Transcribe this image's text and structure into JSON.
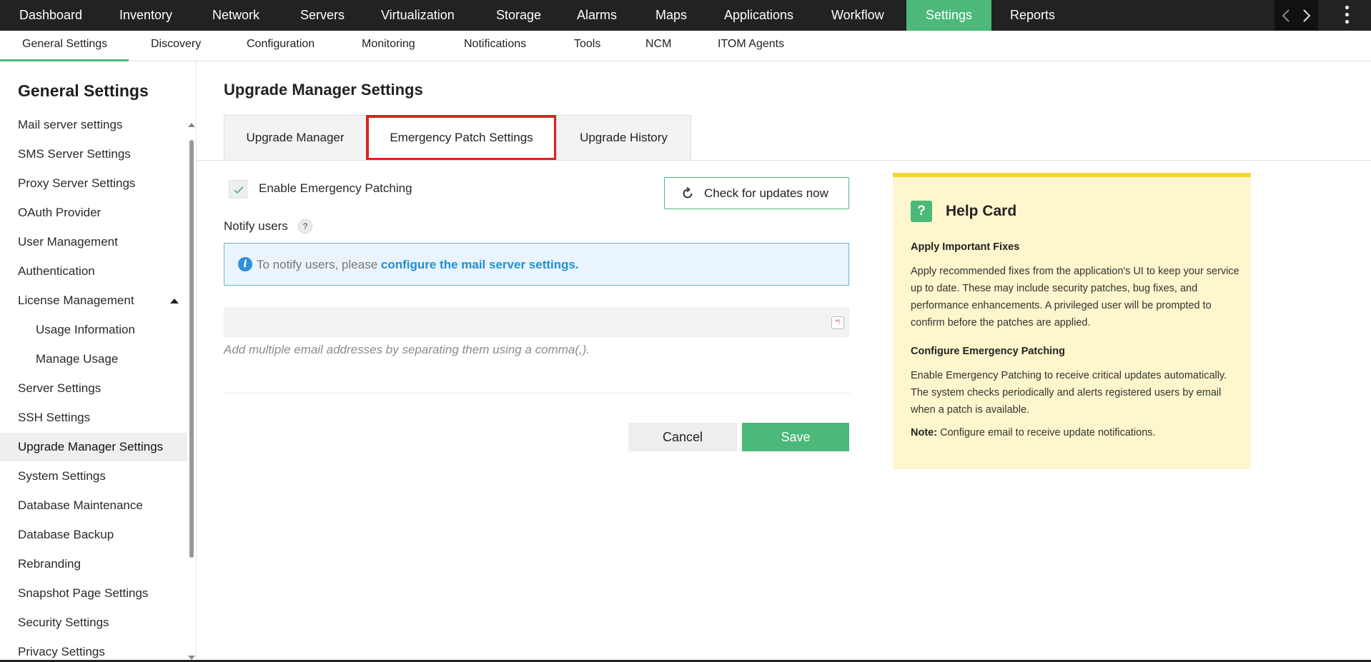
{
  "topnav": {
    "items": [
      "Dashboard",
      "Inventory",
      "Network",
      "Servers",
      "Virtualization",
      "Storage",
      "Alarms",
      "Maps",
      "Applications",
      "Workflow",
      "Settings",
      "Reports"
    ],
    "active": "Settings"
  },
  "subnav": {
    "items": [
      "General Settings",
      "Discovery",
      "Configuration",
      "Monitoring",
      "Notifications",
      "Tools",
      "NCM",
      "ITOM Agents"
    ],
    "active": "General Settings"
  },
  "sidebar": {
    "title": "General Settings",
    "items": [
      "Mail server settings",
      "SMS Server Settings",
      "Proxy Server Settings",
      "OAuth Provider",
      "User Management",
      "Authentication",
      "License Management",
      "Usage Information",
      "Manage Usage",
      "Server Settings",
      "SSH Settings",
      "Upgrade Manager Settings",
      "System Settings",
      "Database Maintenance",
      "Database Backup",
      "Rebranding",
      "Snapshot Page Settings",
      "Security Settings",
      "Privacy Settings"
    ],
    "active": "Upgrade Manager Settings"
  },
  "main": {
    "title": "Upgrade Manager Settings",
    "tabs": [
      "Upgrade Manager",
      "Emergency Patch Settings",
      "Upgrade History"
    ],
    "active_tab": "Emergency Patch Settings",
    "enable_label": "Enable Emergency Patching",
    "enable_checked": true,
    "check_updates_label": "Check for updates now",
    "notify_label": "Notify users",
    "notify_help": "?",
    "info_text": "To notify users, please ",
    "info_link": "configure the mail server settings.",
    "email_value": "",
    "email_hint": "Add multiple email addresses by separating them using a comma(,).",
    "cancel_label": "Cancel",
    "save_label": "Save"
  },
  "help_card": {
    "title": "Help Card",
    "heading1": "Apply Important Fixes",
    "para1": "Apply recommended fixes from the application's UI to keep your service up to date. These may include security patches, bug fixes, and performance enhancements. A privileged user will be prompted to confirm before the patches are applied.",
    "heading2": "Configure Emergency Patching",
    "para2": "Enable Emergency Patching to receive critical updates automatically. The system checks periodically and alerts registered users by email when a patch is available.",
    "note_label": "Note:",
    "note_text": " Configure email to receive update notifications."
  },
  "colors": {
    "accent": "#4cb87a",
    "topbar": "#222222",
    "highlight": "#e02020",
    "info_bg": "#e9f4fc",
    "help_bg": "#fef6cc"
  }
}
